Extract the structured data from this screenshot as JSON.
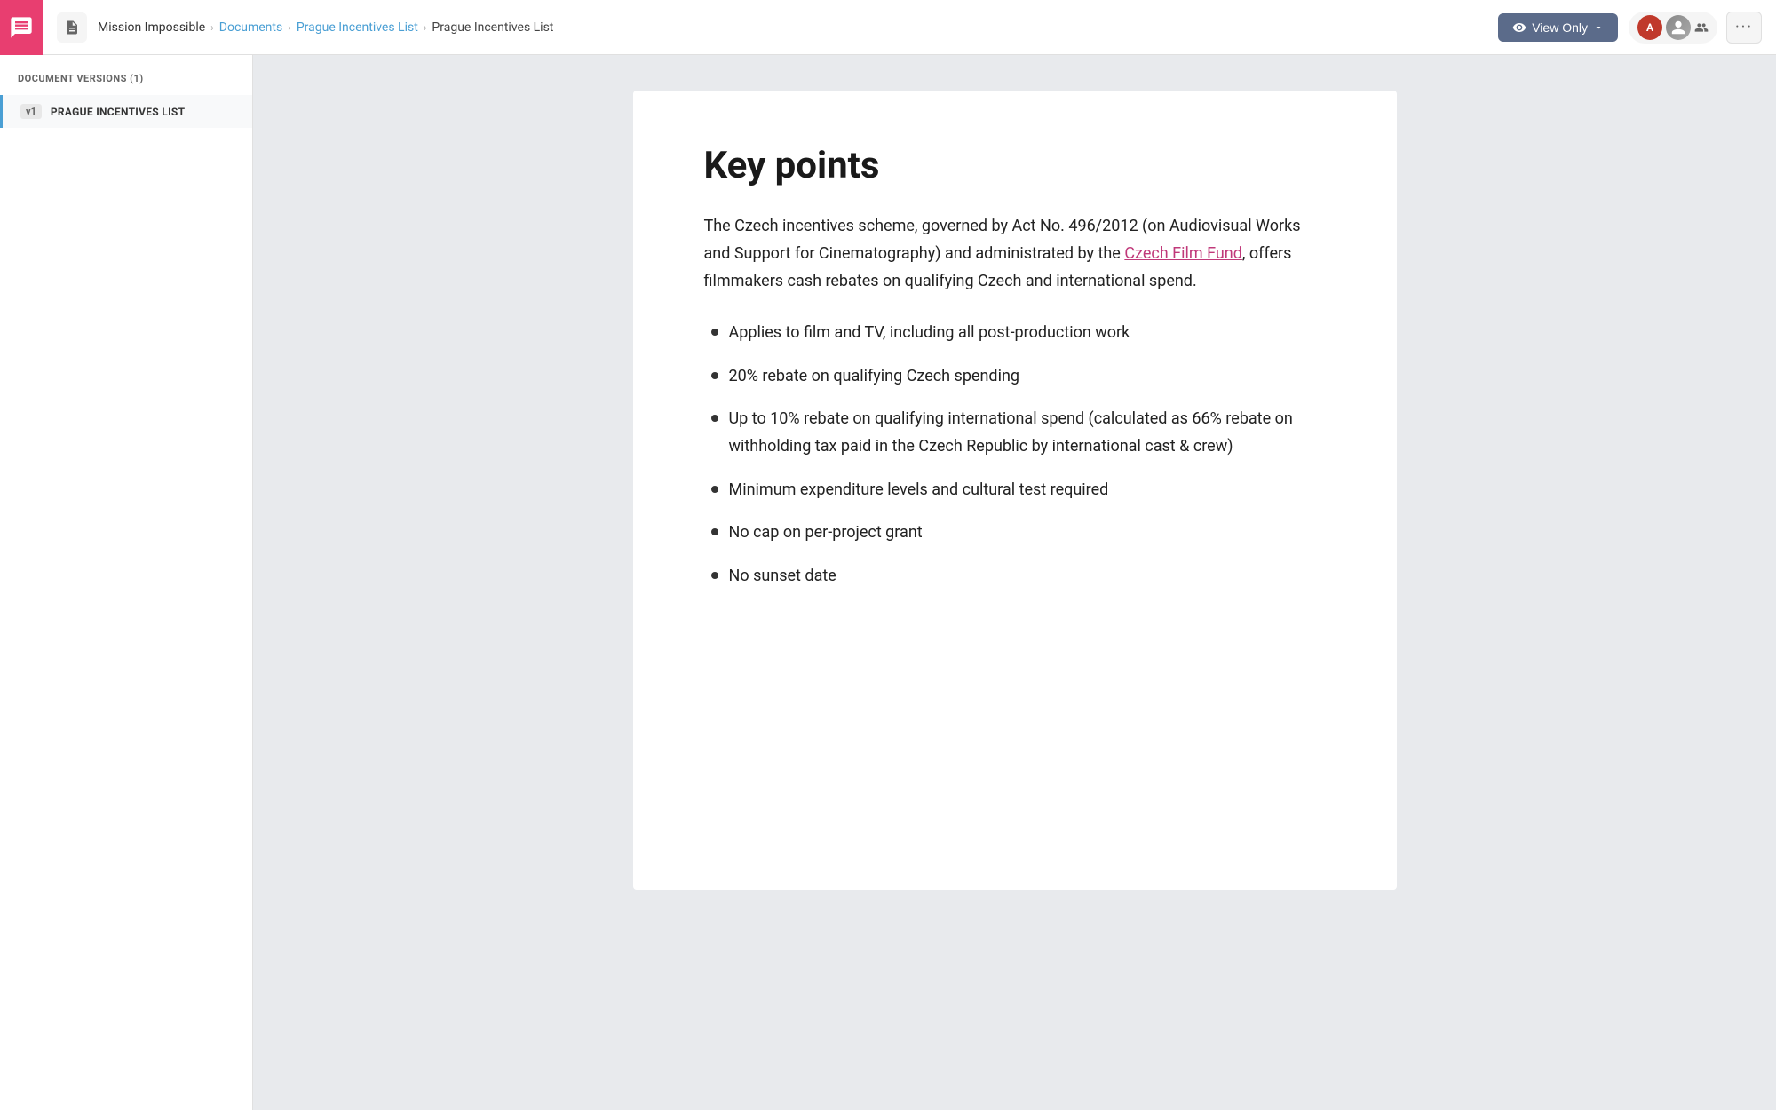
{
  "topbar": {
    "app_icon_label": "chat-icon",
    "nav_icon_label": "document-nav-icon",
    "breadcrumb": {
      "project": "Mission Impossible",
      "section": "Documents",
      "sub": "Prague Incentives List",
      "current": "Prague Incentives List"
    },
    "view_only_label": "View Only",
    "more_label": "···"
  },
  "sidebar": {
    "section_title": "DOCUMENT VERSIONS (1)",
    "items": [
      {
        "version": "v1",
        "label": "PRAGUE INCENTIVES LIST"
      }
    ]
  },
  "document": {
    "heading": "Key points",
    "paragraph": "The Czech incentives scheme, governed by Act No. 496/2012 (on Audiovisual Works and Support for Cinematography) and administrated by the",
    "link_text": "Czech Film Fund",
    "paragraph_end": ", offers filmmakers cash rebates on qualifying Czech and international spend.",
    "bullet_items": [
      "Applies to film and TV, including all post-production work",
      "20% rebate on qualifying Czech spending",
      "Up to 10% rebate on qualifying international spend (calculated as 66% rebate on withholding tax paid in the Czech Republic by international cast & crew)",
      "Minimum expenditure levels and cultural test required",
      "No cap on per-project grant",
      "No sunset date"
    ]
  }
}
